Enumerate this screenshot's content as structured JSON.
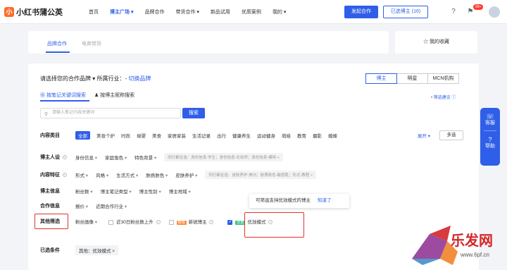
{
  "app": {
    "logo_mark": "小",
    "name": "小红书蒲公英"
  },
  "nav": [
    "首页",
    "博主广场",
    "品牌合作",
    "带货合作",
    "新品试用",
    "优质案例",
    "我的"
  ],
  "header": {
    "primary_btn": "发起合作",
    "selected_btn": "已选博主 (16)",
    "notif_badge": "99+"
  },
  "tabs": {
    "active": "品牌合作",
    "inactive": "电商带货",
    "favorites": "☆ 我的收藏"
  },
  "brand": {
    "title": "请选择您的合作品牌 ▾  所属行业：- ",
    "switch": "切换品牌"
  },
  "segments": [
    "博主",
    "明星",
    "MCN机构"
  ],
  "subtabs": [
    "按笔记关键词搜索",
    "按博主昵称搜索"
  ],
  "filter_tip": "筛选建议",
  "search": {
    "placeholder": "请输入笔记内容关键词",
    "button": "搜索"
  },
  "rows": {
    "content_category": {
      "label": "内容类目",
      "items": [
        "全部",
        "美妆个护",
        "时尚",
        "母婴",
        "美食",
        "家居家装",
        "生活记录",
        "出行",
        "健康养生",
        "运动健身",
        "萌娃",
        "教育",
        "摄影",
        "婚嫁"
      ],
      "more": "展开",
      "multi": "多选"
    },
    "persona": {
      "label": "博主人设",
      "dropdowns": [
        "身份信息",
        "家庭角色",
        "特色背景"
      ],
      "hint": "同行都在选：身份信息-学生；身份信息-化妆师；身份信息-模特 ×"
    },
    "content_feature": {
      "label": "内容特征",
      "dropdowns": [
        "形式",
        "风格",
        "生活方式",
        "肤质肤色",
        "皮肤养护"
      ],
      "hint": "同行都在选：皮肤养护-美白；肤质肤色-敏感肌；形式-教程 ×"
    },
    "blogger_info": {
      "label": "博主信息",
      "dropdowns": [
        "粉丝数",
        "博主笔记类型",
        "博主性别",
        "博主地域"
      ]
    },
    "coop_info": {
      "label": "合作信息",
      "dropdowns": [
        "报价",
        "近期合作行业"
      ]
    },
    "other": {
      "label": "其他筛选",
      "dropdown": "粉丝画像",
      "cb1": "近30日粉丝数上升",
      "cb2_tag": "新锐",
      "cb2": "新锐博主",
      "cb3_tag": "优质",
      "cb3": "优效模式"
    }
  },
  "tooltip": {
    "text": "可筛选支持优效模式的博主",
    "action": "知道了"
  },
  "selected": {
    "label": "已选条件",
    "tag": "其他：优效模式 ×"
  },
  "float_panel": {
    "service": "客服",
    "help": "帮助"
  },
  "watermark": {
    "text": "乐发网",
    "url": "www.6pf.cn"
  },
  "colors": {
    "primary": "#2f5fe8",
    "highlight_box": "#e0332b"
  }
}
